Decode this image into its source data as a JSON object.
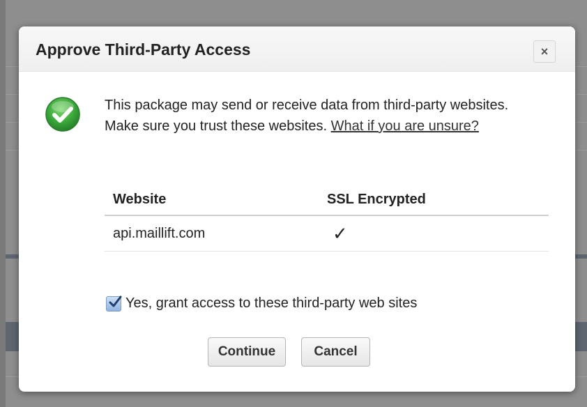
{
  "dialog": {
    "title": "Approve Third-Party Access",
    "close_label": "×",
    "message": "This package may send or receive data from third-party websites. Make sure you trust these websites. ",
    "help_link": "What if you are unsure?",
    "table": {
      "headers": [
        "Website",
        "SSL Encrypted"
      ],
      "rows": [
        {
          "website": "api.maillift.com",
          "ssl": "✓"
        }
      ]
    },
    "grant_checkbox": {
      "label": "Yes, grant access to these third-party web sites",
      "checked": true
    },
    "buttons": {
      "continue": "Continue",
      "cancel": "Cancel"
    }
  },
  "icons": {
    "success_badge": "check-circle-icon",
    "close": "close-icon"
  },
  "colors": {
    "success_green": "#3aa83a",
    "overlay_gray": "#8e8e8e"
  }
}
